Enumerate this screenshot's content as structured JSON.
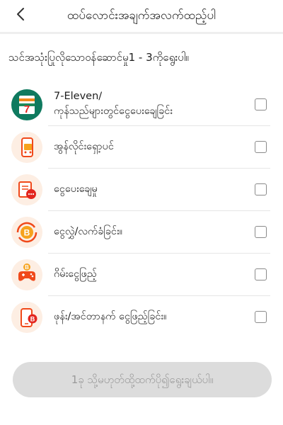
{
  "header": {
    "title": "ထပ်လောင်းအချက်အလက်ထည့်ပါ",
    "back_icon": "chevron-left-icon"
  },
  "question": "သင်အသုံးပြုလိုသောဝန်ဆောင်မှု1 - 3ကိုရွေးပါ။",
  "options": [
    {
      "line1": "7-Eleven/",
      "line2": "ကုန်သည်များတွင်ငွေပေးချေခြင်း",
      "icon": "7-eleven-logo-icon",
      "checked": false
    },
    {
      "label": "အွန်လိုင်းရှော့ပင်",
      "icon": "online-shopping-phone-icon",
      "checked": false
    },
    {
      "label": "ငွေပေးချေမှု",
      "icon": "bill-payment-icon",
      "checked": false
    },
    {
      "label": "ငွေလွှဲ/လက်ခံခြင်း။",
      "icon": "money-transfer-coin-icon",
      "checked": false
    },
    {
      "label": "ဂိမ်းငွေဖြည့်",
      "icon": "game-controller-icon",
      "checked": false
    },
    {
      "label": "ဖုန်း/အင်တာနက် ငွေဖြည့်ခြင်း။",
      "icon": "mobile-topup-icon",
      "checked": false
    }
  ],
  "submit_label": "1ခု သို့မဟုတ်ထို့ထက်ပို၍ရွေးချယ်ပါ။",
  "colors": {
    "accent": "#f0491a",
    "button_disabled": "#dcdcdc"
  }
}
